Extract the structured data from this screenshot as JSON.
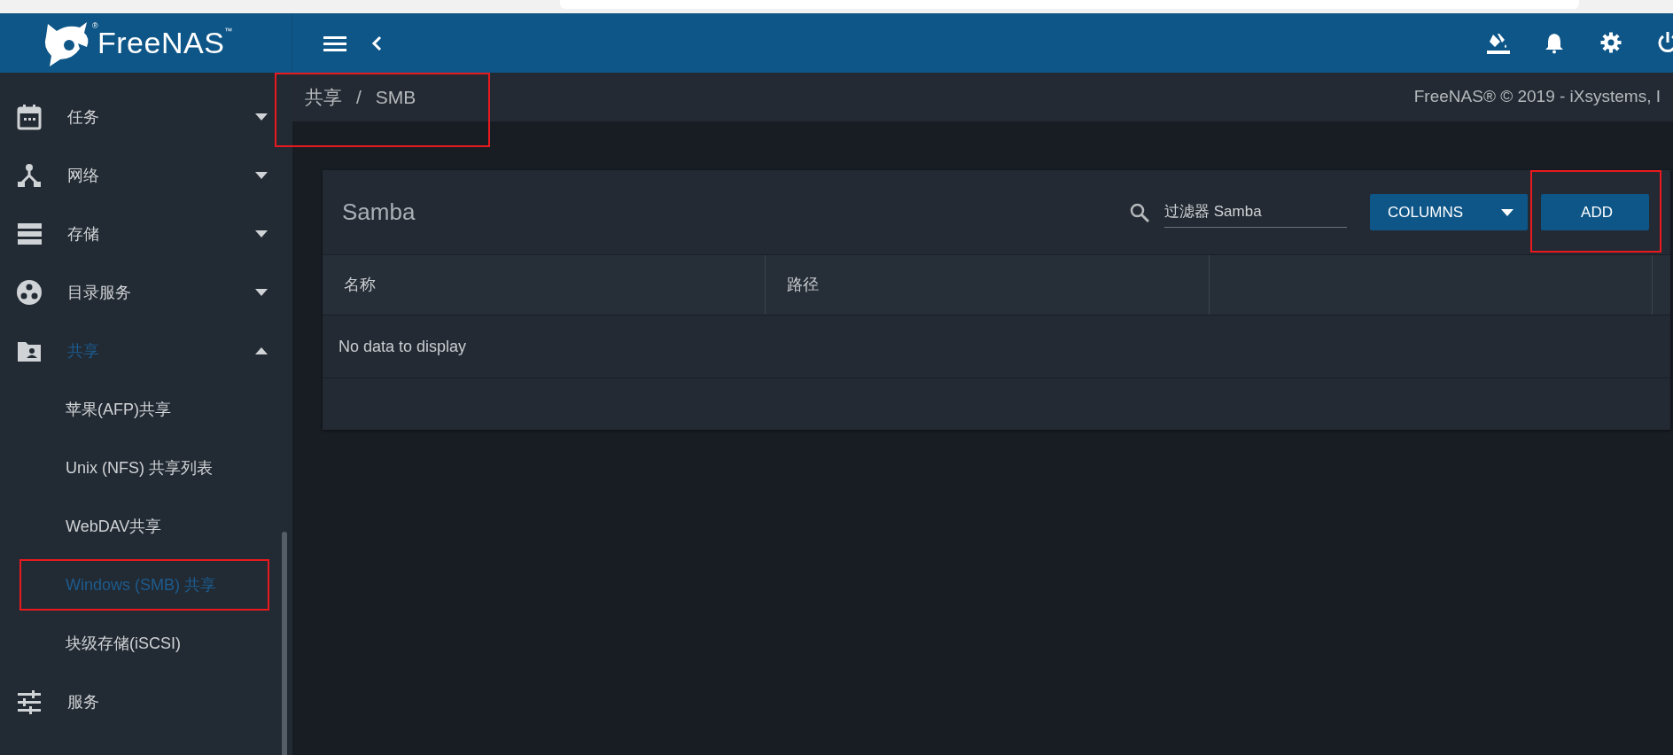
{
  "logo": {
    "text": "FreeNAS$^{™}$",
    "mark": "®"
  },
  "header": {
    "icons": [
      {
        "kind": "paint"
      },
      {
        "kind": "bell"
      },
      {
        "kind": "gear"
      },
      {
        "kind": "power"
      }
    ]
  },
  "breadcrumb": {
    "items": [
      "共享",
      "SMB"
    ],
    "separator": "/",
    "highlighted": true
  },
  "copyright": "FreeNAS® © 2019 - iXsystems, I",
  "sidebar": {
    "items": [
      {
        "label": "任务",
        "kind": "calendar",
        "expanded": false,
        "selected": false
      },
      {
        "label": "网络",
        "kind": "network",
        "expanded": false,
        "selected": false
      },
      {
        "label": "存储",
        "kind": "storage",
        "expanded": false,
        "selected": false
      },
      {
        "label": "目录服务",
        "kind": "directory",
        "expanded": false,
        "selected": false
      },
      {
        "label": "共享",
        "kind": "folder",
        "expanded": true,
        "selected": true,
        "children": [
          {
            "label": "苹果(AFP)共享",
            "selected": false,
            "highlighted": false
          },
          {
            "label": "Unix (NFS) 共享列表",
            "selected": false,
            "highlighted": false
          },
          {
            "label": "WebDAV共享",
            "selected": false,
            "highlighted": false
          },
          {
            "label": "Windows (SMB) 共享",
            "selected": true,
            "highlighted": true
          },
          {
            "label": "块级存储(iSCSI)",
            "selected": false,
            "highlighted": false
          }
        ]
      },
      {
        "label": "服务",
        "kind": "sliders",
        "selected": false
      }
    ]
  },
  "card": {
    "title": "Samba",
    "search": {
      "value": "过滤器 Samba"
    },
    "buttons": [
      {
        "label": "COLUMNS",
        "kind": "dropdown",
        "highlighted": false
      },
      {
        "label": "ADD",
        "kind": "plain",
        "highlighted": true
      }
    ],
    "table": {
      "columns": [
        "名称",
        "路径",
        null
      ],
      "empty_message": "No data to display"
    }
  }
}
